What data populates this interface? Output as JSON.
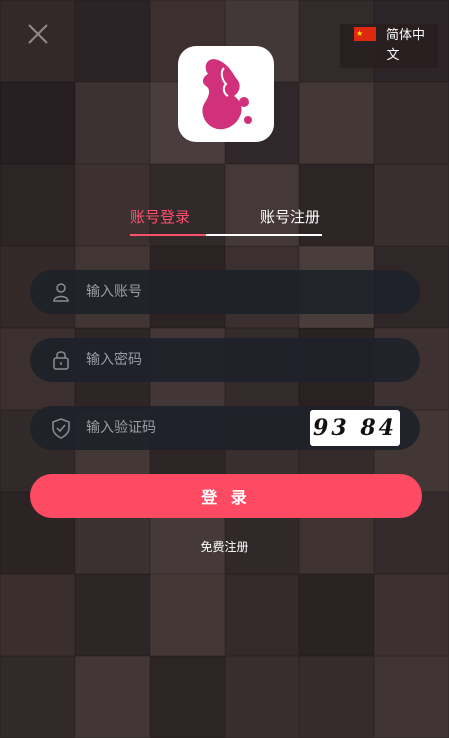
{
  "language": {
    "label_line1": "简体中",
    "label_line2": "文",
    "flag": "china-flag-icon"
  },
  "tabs": {
    "login": "账号登录",
    "register": "账号注册"
  },
  "fields": {
    "account_placeholder": "输入账号",
    "password_placeholder": "输入密码",
    "captcha_placeholder": "输入验证码",
    "captcha_image_text": "93 84"
  },
  "actions": {
    "login": "登 录",
    "free_register": "免费注册"
  },
  "colors": {
    "accent": "#ff4a63",
    "field_bg": "#1e222a",
    "background": "#3a2a2c"
  }
}
